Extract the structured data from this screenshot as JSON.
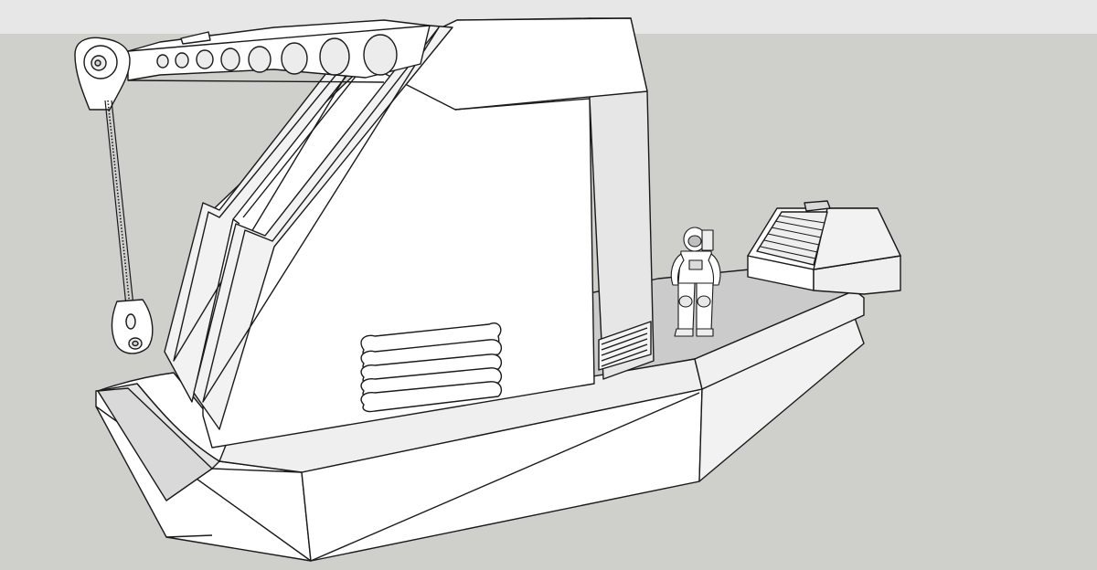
{
  "scene": {
    "sky_color": "#e6e7e6",
    "ground_color": "#cfd0cb",
    "surface_color": "#ffffff",
    "shade_color": "#e4e4e4",
    "deck_color": "#cbcbcb",
    "line_color": "#1a1a1a"
  },
  "objects": [
    "crane-boat-model",
    "crane-cab",
    "crane-boom",
    "crane-hook",
    "deck-hatch",
    "astronaut-figure"
  ]
}
